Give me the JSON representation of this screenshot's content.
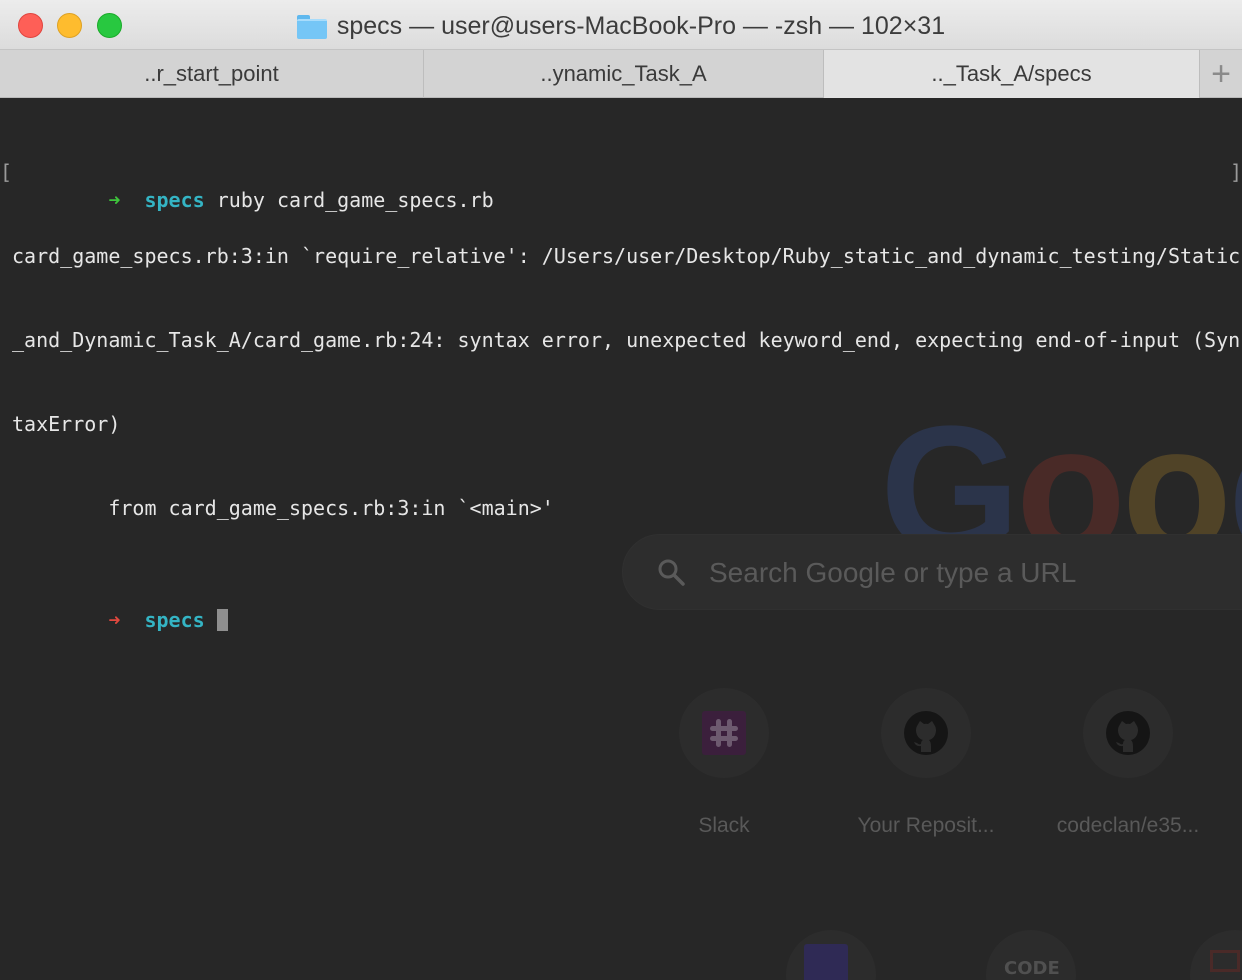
{
  "window": {
    "title": "specs — user@users-MacBook-Pro — -zsh — 102×31"
  },
  "tabs": [
    {
      "label": "..r_start_point"
    },
    {
      "label": "..ynamic_Task_A"
    },
    {
      "label": ".._Task_A/specs"
    }
  ],
  "tab_add": "+",
  "terminal": {
    "prompt_arrow": "➜",
    "prompt_dir": "specs",
    "command": "ruby card_game_specs.rb",
    "output": [
      "card_game_specs.rb:3:in `require_relative': /Users/user/Desktop/Ruby_static_and_dynamic_testing/Static",
      "_and_Dynamic_Task_A/card_game.rb:24: syntax error, unexpected keyword_end, expecting end-of-input (Syn",
      "taxError)",
      "        from card_game_specs.rb:3:in `<main>'"
    ],
    "bracket_left": "[",
    "bracket_right": "]"
  },
  "background_page": {
    "logo_text": "Goog",
    "search_placeholder": "Search Google or type a URL",
    "shortcuts": [
      {
        "label": "Slack",
        "icon": "slack-icon"
      },
      {
        "label": "Your Reposit...",
        "icon": "github-icon"
      },
      {
        "label": "codeclan/e35...",
        "icon": "github-icon"
      }
    ],
    "bottom_icon_text": "CODE"
  }
}
